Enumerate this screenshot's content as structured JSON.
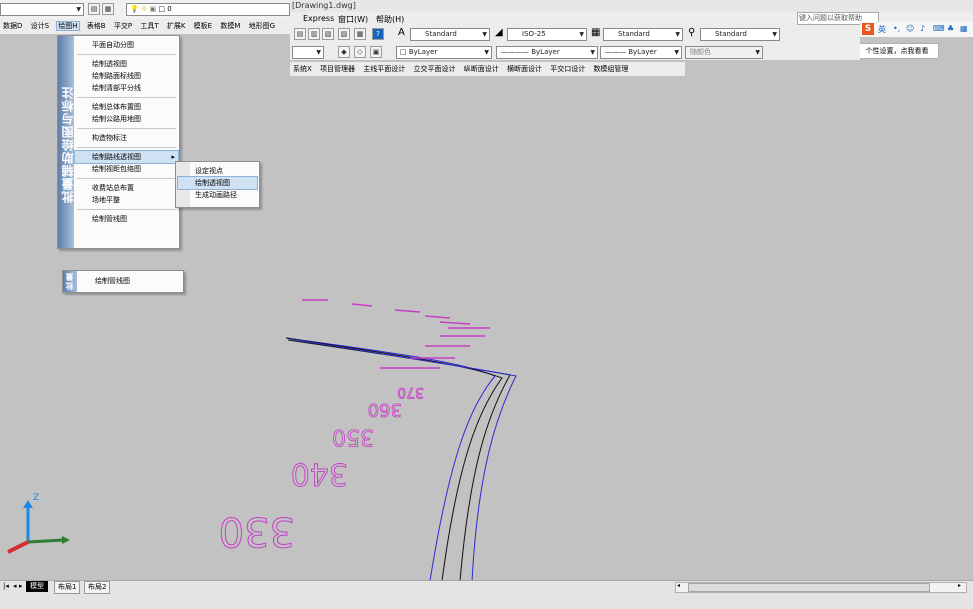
{
  "title_bar": {
    "title": "[Drawing1.dwg]"
  },
  "menu_right": {
    "express": "Express",
    "window": "窗口(W)",
    "help": "帮助(H)"
  },
  "help_search": {
    "placeholder": "键入问题以获取帮助"
  },
  "ime": {
    "logo": "S",
    "tooltip": "个性设置，点我看看"
  },
  "top_left_toolbar": {
    "layer_value": "0"
  },
  "main_menu": [
    "数据D",
    "设计S",
    "绘图H",
    "表格B",
    "平交P",
    "工具T",
    "扩展K",
    "模板E",
    "数模M",
    "地形图G"
  ],
  "styles_toolbar": {
    "text_style": "Standard",
    "dim_style": "ISO-25",
    "table_style": "Standard",
    "ml_style": "Standard"
  },
  "properties_toolbar": {
    "layer": "ByLayer",
    "linetype": "ByLayer",
    "lineweight": "ByLayer",
    "plotstyle": "随颜色"
  },
  "hint_menu": [
    "系统X",
    "项目管理器",
    "主线平面设计",
    "立交平面设计",
    "纵断面设计",
    "横断面设计",
    "平交口设计",
    "数模组管理"
  ],
  "dropdown": {
    "sidebar_text": "批量辅助绘图与标注",
    "items": [
      "平面自动分图",
      "绘制透视图",
      "绘制路面标线图",
      "绘制清部平分线",
      "绘制总体布置图",
      "绘制公路用地图",
      "构造物标注",
      "绘制路线透视图",
      "绘制视距包络图",
      "收费站总布置",
      "场地平整",
      "绘制管线图"
    ]
  },
  "submenu": {
    "items": [
      "设定视点",
      "绘制透视图",
      "生成动画路径"
    ]
  },
  "torn_menu": {
    "sidebar_text": "批量",
    "item": "绘制管线图"
  },
  "drawing": {
    "station_labels": [
      "330",
      "340",
      "350",
      "360",
      "370"
    ]
  },
  "tabs": {
    "model": "模型",
    "layout1": "布局1",
    "layout2": "布局2"
  },
  "colors": {
    "accent": "#cfe1f3",
    "road_line": "#2b2bd0",
    "station_text": "#c73ec7",
    "axis_z": "#1e88e5",
    "axis_x": "#d32f2f",
    "axis_y": "#2e7d32"
  }
}
